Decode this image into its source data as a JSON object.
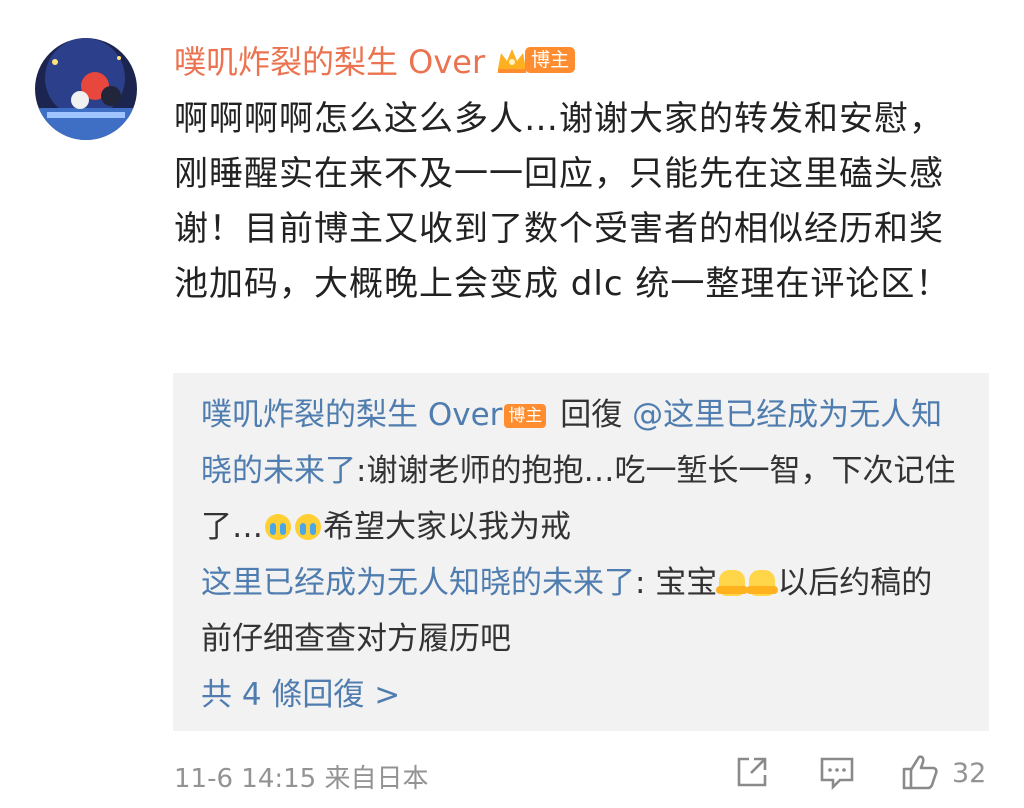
{
  "comment": {
    "author": "噗叽炸裂的梨生 Over",
    "author_badge": "博主",
    "text": "啊啊啊啊怎么这么多人…谢谢大家的转发和安慰，刚睡醒实在来不及一一回应，只能先在这里磕头感谢！目前博主又收到了数个受害者的相似经历和奖池加码，大概晚上会变成 dlc 统一整理在评论区！"
  },
  "replies": {
    "reply1": {
      "author": "噗叽炸裂的梨生 Over",
      "author_badge": "博主",
      "reply_word": " 回復 ",
      "target": "@这里已经成为无人知晓的未来了",
      "text_before_emojis": ":谢谢老师的抱抱…吃一堑长一智，下次记住了…",
      "text_after_emojis": "希望大家以我为戒"
    },
    "reply2": {
      "author": "这里已经成为无人知晓的未来了",
      "text_before_emojis": ": 宝宝",
      "text_after_emojis": "以后约稿的前仔细查查对方履历吧"
    },
    "more_label": "共 4 條回復 >"
  },
  "footer": {
    "timestamp": "11-6 14:15",
    "source": "来自日本",
    "like_count": "32"
  },
  "colors": {
    "author_orange": "#eb7350",
    "link_blue": "#507daf",
    "badge_orange": "#ff8d2f",
    "meta_gray": "#939393",
    "reply_bg": "#f2f2f2"
  },
  "icons": [
    "crown-vip-icon",
    "cry-emoji-icon",
    "hug-emoji-icon",
    "share-icon",
    "comment-icon",
    "like-icon"
  ]
}
